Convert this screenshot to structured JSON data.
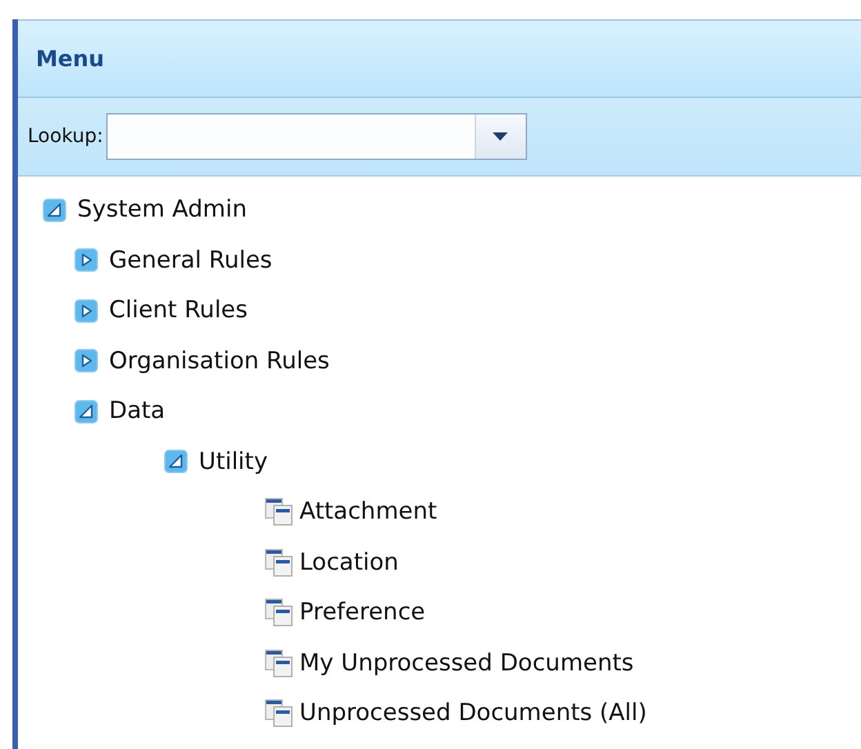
{
  "panel": {
    "title": "Menu"
  },
  "lookup": {
    "label": "Lookup:"
  },
  "tree": [
    {
      "label": "System Admin",
      "kind": "folder",
      "expanded": true,
      "children": [
        {
          "label": "General Rules",
          "kind": "folder",
          "expanded": false
        },
        {
          "label": "Client Rules",
          "kind": "folder",
          "expanded": false
        },
        {
          "label": "Organisation Rules",
          "kind": "folder",
          "expanded": false
        },
        {
          "label": "Data",
          "kind": "folder",
          "expanded": true,
          "children": [
            {
              "label": "Utility",
              "kind": "folder",
              "expanded": true,
              "children": [
                {
                  "label": "Attachment",
                  "kind": "item"
                },
                {
                  "label": "Location",
                  "kind": "item"
                },
                {
                  "label": "Preference",
                  "kind": "item"
                },
                {
                  "label": "My Unprocessed Documents",
                  "kind": "item"
                },
                {
                  "label": "Unprocessed Documents (All)",
                  "kind": "item"
                }
              ]
            }
          ]
        }
      ]
    }
  ]
}
